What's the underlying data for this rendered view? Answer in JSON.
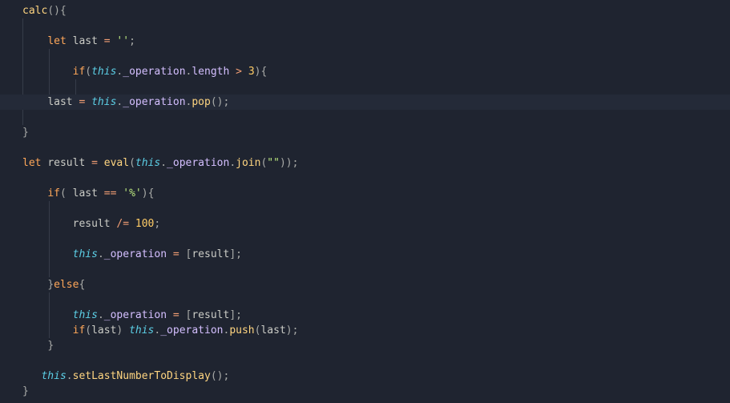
{
  "code": {
    "lines": [
      {
        "indent": 0,
        "hl": false,
        "guides": [],
        "tokens": [
          {
            "t": "fnname",
            "v": "calc"
          },
          {
            "t": "punc",
            "v": "()"
          },
          {
            "t": "punc",
            "v": "{"
          }
        ]
      },
      {
        "indent": 0,
        "hl": false,
        "guides": [
          1
        ],
        "tokens": []
      },
      {
        "indent": 4,
        "hl": false,
        "guides": [
          1
        ],
        "tokens": [
          {
            "t": "kw",
            "v": "let"
          },
          {
            "t": "sp",
            "v": " "
          },
          {
            "t": "var",
            "v": "last"
          },
          {
            "t": "sp",
            "v": " "
          },
          {
            "t": "op",
            "v": "="
          },
          {
            "t": "sp",
            "v": " "
          },
          {
            "t": "str",
            "v": "''"
          },
          {
            "t": "punc",
            "v": ";"
          }
        ]
      },
      {
        "indent": 0,
        "hl": false,
        "guides": [
          1,
          2
        ],
        "tokens": []
      },
      {
        "indent": 8,
        "hl": false,
        "guides": [
          1,
          2
        ],
        "tokens": [
          {
            "t": "kw",
            "v": "if"
          },
          {
            "t": "punc",
            "v": "("
          },
          {
            "t": "this",
            "v": "this"
          },
          {
            "t": "punc",
            "v": "."
          },
          {
            "t": "prop",
            "v": "_operation"
          },
          {
            "t": "punc",
            "v": "."
          },
          {
            "t": "prop",
            "v": "length"
          },
          {
            "t": "sp",
            "v": " "
          },
          {
            "t": "op",
            "v": ">"
          },
          {
            "t": "sp",
            "v": " "
          },
          {
            "t": "num",
            "v": "3"
          },
          {
            "t": "punc",
            "v": ")"
          },
          {
            "t": "punc",
            "v": "{"
          }
        ]
      },
      {
        "indent": 0,
        "hl": false,
        "guides": [
          1,
          2,
          3
        ],
        "tokens": []
      },
      {
        "indent": 4,
        "hl": true,
        "guides": [],
        "tokens": [
          {
            "t": "var",
            "v": "last"
          },
          {
            "t": "sp",
            "v": " "
          },
          {
            "t": "op",
            "v": "="
          },
          {
            "t": "sp",
            "v": " "
          },
          {
            "t": "this",
            "v": "this"
          },
          {
            "t": "punc",
            "v": "."
          },
          {
            "t": "prop",
            "v": "_operation"
          },
          {
            "t": "punc",
            "v": "."
          },
          {
            "t": "fnname",
            "v": "pop"
          },
          {
            "t": "punc",
            "v": "()"
          },
          {
            "t": "punc",
            "v": ";"
          }
        ]
      },
      {
        "indent": 0,
        "hl": false,
        "guides": [
          1
        ],
        "tokens": []
      },
      {
        "indent": 0,
        "hl": false,
        "guides": [],
        "tokens": [
          {
            "t": "punc",
            "v": "}"
          }
        ]
      },
      {
        "indent": 0,
        "hl": false,
        "guides": [],
        "tokens": []
      },
      {
        "indent": 0,
        "hl": false,
        "guides": [],
        "tokens": [
          {
            "t": "kw",
            "v": "let"
          },
          {
            "t": "sp",
            "v": " "
          },
          {
            "t": "var",
            "v": "result"
          },
          {
            "t": "sp",
            "v": " "
          },
          {
            "t": "op",
            "v": "="
          },
          {
            "t": "sp",
            "v": " "
          },
          {
            "t": "fnname",
            "v": "eval"
          },
          {
            "t": "punc",
            "v": "("
          },
          {
            "t": "this",
            "v": "this"
          },
          {
            "t": "punc",
            "v": "."
          },
          {
            "t": "prop",
            "v": "_operation"
          },
          {
            "t": "punc",
            "v": "."
          },
          {
            "t": "fnname",
            "v": "join"
          },
          {
            "t": "punc",
            "v": "("
          },
          {
            "t": "str",
            "v": "\"\""
          },
          {
            "t": "punc",
            "v": "))"
          },
          {
            "t": "punc",
            "v": ";"
          }
        ]
      },
      {
        "indent": 0,
        "hl": false,
        "guides": [],
        "tokens": []
      },
      {
        "indent": 4,
        "hl": false,
        "guides": [],
        "tokens": [
          {
            "t": "kw",
            "v": "if"
          },
          {
            "t": "punc",
            "v": "("
          },
          {
            "t": "sp",
            "v": " "
          },
          {
            "t": "var",
            "v": "last"
          },
          {
            "t": "sp",
            "v": " "
          },
          {
            "t": "op",
            "v": "=="
          },
          {
            "t": "sp",
            "v": " "
          },
          {
            "t": "str",
            "v": "'%'"
          },
          {
            "t": "punc",
            "v": ")"
          },
          {
            "t": "punc",
            "v": "{"
          }
        ]
      },
      {
        "indent": 0,
        "hl": false,
        "guides": [
          2
        ],
        "tokens": []
      },
      {
        "indent": 8,
        "hl": false,
        "guides": [
          2
        ],
        "tokens": [
          {
            "t": "var",
            "v": "result"
          },
          {
            "t": "sp",
            "v": " "
          },
          {
            "t": "op",
            "v": "/="
          },
          {
            "t": "sp",
            "v": " "
          },
          {
            "t": "num",
            "v": "100"
          },
          {
            "t": "punc",
            "v": ";"
          }
        ]
      },
      {
        "indent": 0,
        "hl": false,
        "guides": [
          2
        ],
        "tokens": []
      },
      {
        "indent": 8,
        "hl": false,
        "guides": [
          2
        ],
        "tokens": [
          {
            "t": "this",
            "v": "this"
          },
          {
            "t": "punc",
            "v": "."
          },
          {
            "t": "prop",
            "v": "_operation"
          },
          {
            "t": "sp",
            "v": " "
          },
          {
            "t": "op",
            "v": "="
          },
          {
            "t": "sp",
            "v": " "
          },
          {
            "t": "punc",
            "v": "["
          },
          {
            "t": "var",
            "v": "result"
          },
          {
            "t": "punc",
            "v": "]"
          },
          {
            "t": "punc",
            "v": ";"
          }
        ]
      },
      {
        "indent": 0,
        "hl": false,
        "guides": [
          2
        ],
        "tokens": []
      },
      {
        "indent": 4,
        "hl": false,
        "guides": [],
        "tokens": [
          {
            "t": "punc",
            "v": "}"
          },
          {
            "t": "kw",
            "v": "else"
          },
          {
            "t": "punc",
            "v": "{"
          }
        ]
      },
      {
        "indent": 0,
        "hl": false,
        "guides": [
          2
        ],
        "tokens": []
      },
      {
        "indent": 8,
        "hl": false,
        "guides": [
          2
        ],
        "tokens": [
          {
            "t": "this",
            "v": "this"
          },
          {
            "t": "punc",
            "v": "."
          },
          {
            "t": "prop",
            "v": "_operation"
          },
          {
            "t": "sp",
            "v": " "
          },
          {
            "t": "op",
            "v": "="
          },
          {
            "t": "sp",
            "v": " "
          },
          {
            "t": "punc",
            "v": "["
          },
          {
            "t": "var",
            "v": "result"
          },
          {
            "t": "punc",
            "v": "]"
          },
          {
            "t": "punc",
            "v": ";"
          }
        ]
      },
      {
        "indent": 8,
        "hl": false,
        "guides": [
          2
        ],
        "tokens": [
          {
            "t": "kw",
            "v": "if"
          },
          {
            "t": "punc",
            "v": "("
          },
          {
            "t": "var",
            "v": "last"
          },
          {
            "t": "punc",
            "v": ")"
          },
          {
            "t": "sp",
            "v": " "
          },
          {
            "t": "this",
            "v": "this"
          },
          {
            "t": "punc",
            "v": "."
          },
          {
            "t": "prop",
            "v": "_operation"
          },
          {
            "t": "punc",
            "v": "."
          },
          {
            "t": "fnname",
            "v": "push"
          },
          {
            "t": "punc",
            "v": "("
          },
          {
            "t": "var",
            "v": "last"
          },
          {
            "t": "punc",
            "v": ")"
          },
          {
            "t": "punc",
            "v": ";"
          }
        ]
      },
      {
        "indent": 4,
        "hl": false,
        "guides": [],
        "tokens": [
          {
            "t": "punc",
            "v": "}"
          }
        ]
      },
      {
        "indent": 0,
        "hl": false,
        "guides": [],
        "tokens": []
      },
      {
        "indent": 3,
        "hl": false,
        "guides": [],
        "tokens": [
          {
            "t": "this",
            "v": "this"
          },
          {
            "t": "punc",
            "v": "."
          },
          {
            "t": "fnname",
            "v": "setLastNumberToDisplay"
          },
          {
            "t": "punc",
            "v": "()"
          },
          {
            "t": "punc",
            "v": ";"
          }
        ]
      },
      {
        "indent": 0,
        "hl": false,
        "guides": [],
        "tokens": [
          {
            "t": "punc",
            "v": "}"
          }
        ]
      }
    ]
  }
}
